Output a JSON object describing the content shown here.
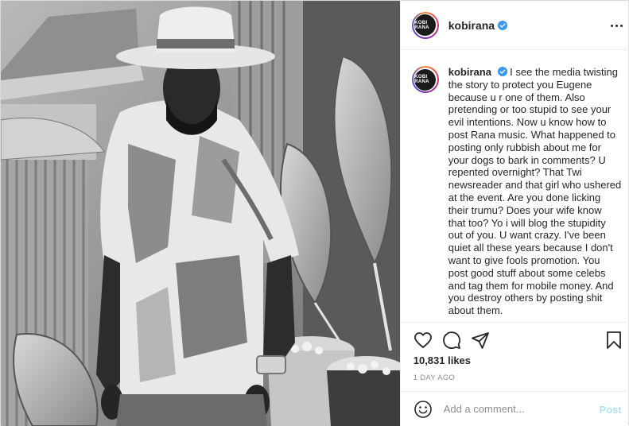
{
  "post": {
    "username": "kobirana",
    "avatar_text": "KOBI RANA",
    "verified": true,
    "caption": "I see the media twisting the story to protect you Eugene because u r one of them. Also pretending or too stupid to see your evil intentions. Now u know how to post Rana music. What happened to posting only rubbish about me for your dogs to bark in comments? U repented overnight? That Twi newsreader and that girl who ushered at the event. Are you done licking their trumu? Does your wife know that too? Yo i will blog the stupidity out of you. U want crazy. I've been quiet all these years because I don't want to give fools promotion. You post good stuff about some celebs and tag them for mobile money. And you destroy others by posting shit about them.",
    "likes": "10,831 likes",
    "timestamp": "1 DAY AGO",
    "comment_placeholder": "Add a comment...",
    "post_button": "Post"
  },
  "icons": {
    "like": "heart-icon",
    "comment": "comment-icon",
    "share": "paper-plane-icon",
    "save": "bookmark-icon",
    "emoji": "smiley-icon",
    "more": "more-options-icon",
    "verified": "verified-badge-icon"
  },
  "colors": {
    "verified_blue": "#3897f0",
    "post_button_disabled": "#b2dffc",
    "secondary_text": "#8e8e8e"
  }
}
